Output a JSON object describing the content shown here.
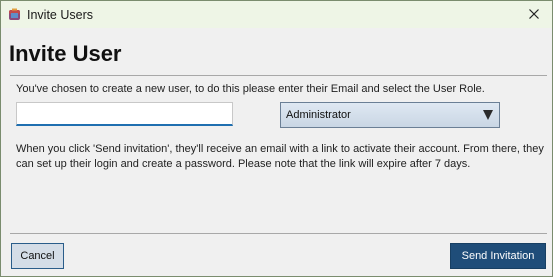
{
  "window": {
    "title": "Invite Users",
    "close_icon": "close-icon",
    "app_icon": "app-icon"
  },
  "dialog": {
    "heading": "Invite User",
    "intro": "You've chosen to create a new user, to do this please enter their Email and select the User Role.",
    "email": {
      "value": "",
      "placeholder": ""
    },
    "role": {
      "selected": "Administrator",
      "icon": "chevron-down-icon"
    },
    "info": "When you click 'Send invitation', they'll receive an email with a link to activate their account. From there, they can set up their login and create a password. Please note that the link will expire after 7 days."
  },
  "actions": {
    "cancel_label": "Cancel",
    "send_label": "Send Invitation"
  },
  "colors": {
    "titlebar": "#eef5e6",
    "accent": "#1f4d79",
    "input_focus": "#1f6fb0"
  }
}
